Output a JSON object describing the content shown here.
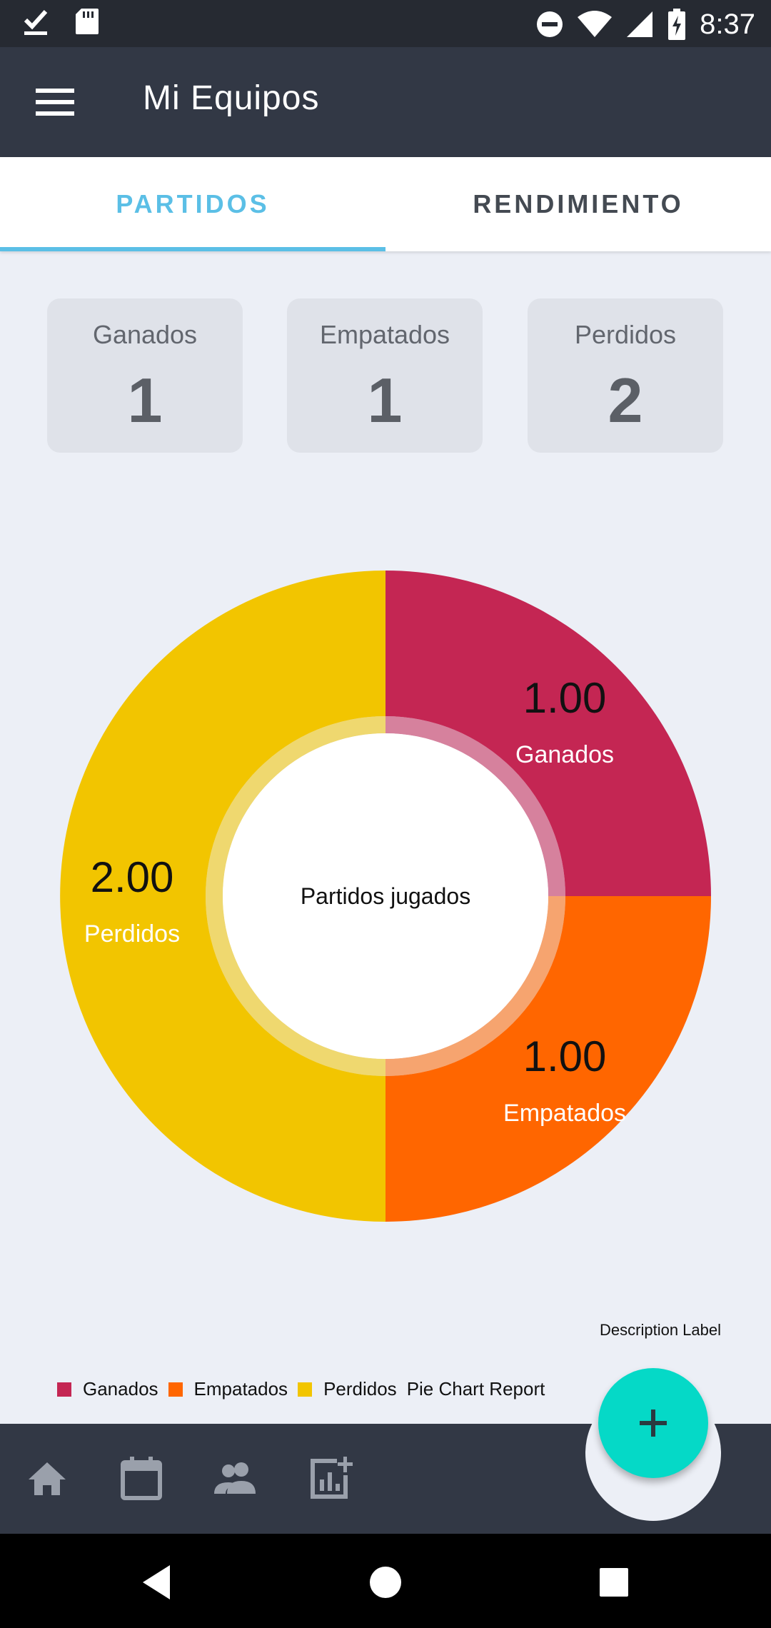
{
  "status_bar": {
    "time": "8:37",
    "left_icons": [
      "download-done-icon",
      "sd-card-icon"
    ],
    "right_icons": [
      "do-not-disturb-icon",
      "wifi-icon",
      "signal-icon",
      "battery-charging-icon"
    ]
  },
  "app_bar": {
    "title": "Mi Equipos",
    "menu_icon": "hamburger-menu-icon"
  },
  "tabs": [
    {
      "label": "PARTIDOS",
      "active": true
    },
    {
      "label": "RENDIMIENTO",
      "active": false
    }
  ],
  "stats": [
    {
      "label": "Ganados",
      "value": "1"
    },
    {
      "label": "Empatados",
      "value": "1"
    },
    {
      "label": "Perdidos",
      "value": "2"
    }
  ],
  "chart_data": {
    "type": "pie",
    "variant": "donut",
    "center_text": "Partidos jugados",
    "description_label": "Description Label",
    "legend_title": "Pie Chart Report",
    "legend_position": "bottom-left",
    "slices": [
      {
        "label": "Ganados",
        "value": 1.0,
        "value_label": "1.00",
        "color": "#c42653"
      },
      {
        "label": "Empatados",
        "value": 1.0,
        "value_label": "1.00",
        "color": "#ff6600"
      },
      {
        "label": "Perdidos",
        "value": 2.0,
        "value_label": "2.00",
        "color": "#f2c500"
      }
    ]
  },
  "bottom_nav": {
    "items": [
      "home-icon",
      "calendar-icon",
      "people-icon",
      "add-chart-icon"
    ],
    "fab_icon": "plus-icon",
    "fab_color": "#05d9c7"
  },
  "system_nav": [
    "back-icon",
    "home-circle-icon",
    "recents-square-icon"
  ]
}
